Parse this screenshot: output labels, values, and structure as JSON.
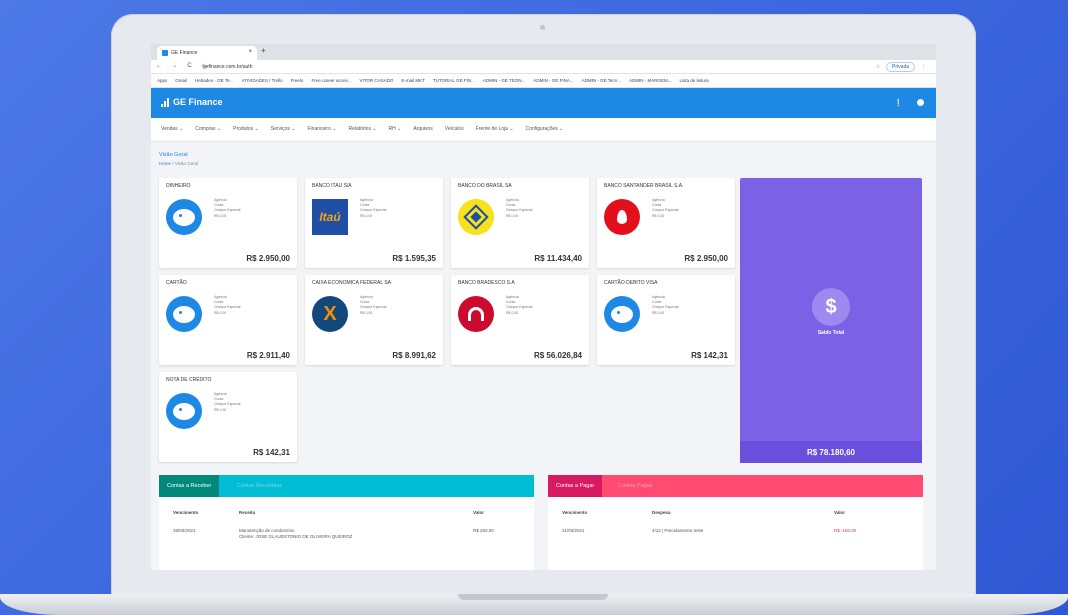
{
  "browser": {
    "tab_title": "GE Finance",
    "tab_close": "×",
    "new_tab": "+",
    "nav_icons": "← → C ⌂",
    "url": "gefinance.com.br/auth",
    "private_label": "Privada",
    "bookmarks": [
      "Apps",
      "Gmail",
      "Hebadeo - GE Te...",
      "ATIVIDADES / Trello",
      "Freelo",
      "Free career acces...",
      "VITOR CASADO",
      "E-mail MKT",
      "TUTORIAL GE FIN...",
      "ADMIN - GE TEON...",
      "ADMIN - GE FINA...",
      "ADMIN - GE Tecn...",
      "ADMIN - MARGEM...",
      "Lista de leitura"
    ]
  },
  "app": {
    "brand": "GE Finance",
    "header_icons": [
      "bell-icon",
      "user-icon"
    ],
    "menu": [
      "Vendas ⌄",
      "Compras ⌄",
      "Produtos ⌄",
      "Serviços ⌄",
      "Financeiro ⌄",
      "Relatórios ⌄",
      "RH ⌄",
      "Arquivos",
      "Veículos",
      "Frente de Loja ⌄",
      "Configurações ⌄"
    ],
    "page_title": "Visão Geral",
    "breadcrumb": {
      "home": "Home",
      "sep": "/",
      "current": "Visão Geral"
    }
  },
  "account_detail_labels": [
    "Agência",
    "Conta",
    "Cheque Especial",
    "R$ 0,00"
  ],
  "accounts": [
    {
      "name": "DINHEIRO",
      "balance": "R$ 2.950,00"
    },
    {
      "name": "BANCO ITAU S/A",
      "balance": "R$ 1.595,35"
    },
    {
      "name": "BANCO DO BRASIL SA",
      "balance": "R$ 11.434,40"
    },
    {
      "name": "BANCO SANTANDER BRASIL S.A.",
      "balance": "R$ 2.950,00"
    },
    {
      "name": "CARTÃO",
      "balance": "R$ 2.911,40"
    },
    {
      "name": "CAIXA ECONOMICA FEDERAL SA",
      "balance": "R$ 8.991,62"
    },
    {
      "name": "BANCO BRADESCO S.A",
      "balance": "R$ 56.026,84"
    },
    {
      "name": "CARTÃO DEBITO VISA",
      "balance": "R$ 142,31"
    },
    {
      "name": "Nota de Crédito",
      "balance": "R$ 142,31"
    }
  ],
  "itau_logo_text": "Itaú",
  "caixa_logo_text": "X",
  "total": {
    "icon": "$",
    "label": "Saldo Total",
    "value": "R$ 78.180,60"
  },
  "receivables": {
    "tab_active": "Contas a Receber",
    "tab_inactive": "Contas Recebidas",
    "headers": [
      "Vencimento",
      "Receita",
      "Valor"
    ],
    "row": {
      "date": "28/03/2021",
      "desc1": "Manutenção de condomínio",
      "desc2": "Cliente: JOSE GLAUDSTONIO DE OLIVEIRA QUEIROZ",
      "value": "R$ 250,00"
    }
  },
  "payables": {
    "tab_active": "Contas a Pagar",
    "tab_inactive": "Contas Pagas",
    "headers": [
      "Vencimento",
      "Despesa",
      "Valor"
    ],
    "row": {
      "date": "31/03/2021",
      "desc": "4/12 | Parcelamento teste",
      "value": "R$ -150,00"
    }
  },
  "colors": {
    "brand_blue": "#1e88e5",
    "total_purple": "#7b61e6",
    "receivable_teal": "#00bcd4",
    "receivable_green": "#00897b",
    "payable_pink": "#ff4b72",
    "payable_dark": "#d81b60"
  }
}
